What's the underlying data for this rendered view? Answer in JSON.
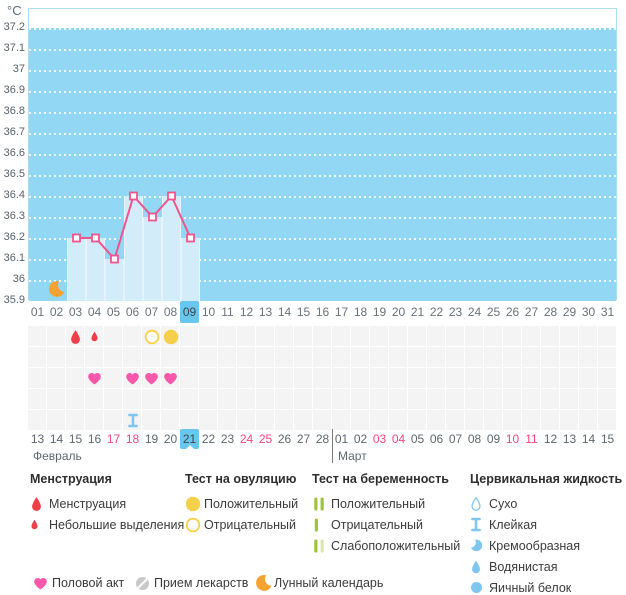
{
  "chart_data": {
    "type": "line",
    "ylabel": "°C",
    "ylim": [
      35.9,
      37.2
    ],
    "y_ticks": [
      "37.2",
      "37.1",
      "37",
      "36.9",
      "36.8",
      "36.7",
      "36.6",
      "36.5",
      "36.4",
      "36.3",
      "36.2",
      "36.1",
      "36",
      "35.9"
    ],
    "x_cycle_days": [
      "01",
      "02",
      "03",
      "04",
      "05",
      "06",
      "07",
      "08",
      "09",
      "10",
      "11",
      "12",
      "13",
      "14",
      "15",
      "16",
      "17",
      "18",
      "19",
      "20",
      "21",
      "22",
      "23",
      "24",
      "25",
      "26",
      "27",
      "28",
      "29",
      "30",
      "31"
    ],
    "current_cycle_day": "09",
    "series": [
      {
        "name": "temperature",
        "points": [
          {
            "day": "03",
            "temp": 36.2
          },
          {
            "day": "04",
            "temp": 36.2
          },
          {
            "day": "05",
            "temp": 36.1
          },
          {
            "day": "06",
            "temp": 36.4
          },
          {
            "day": "07",
            "temp": 36.3
          },
          {
            "day": "08",
            "temp": 36.4
          },
          {
            "day": "09",
            "temp": 36.2
          }
        ]
      }
    ],
    "markers_on_chart": [
      {
        "day": "02",
        "icon": "moon-orange"
      }
    ],
    "event_rows": [
      {
        "name": "menstruation-and-ovulation-tests",
        "items": [
          {
            "day": "03",
            "icon": "drop-large-red"
          },
          {
            "day": "04",
            "icon": "drop-small-red"
          },
          {
            "day": "07",
            "icon": "circle-outline-yellow"
          },
          {
            "day": "08",
            "icon": "circle-filled-yellow"
          }
        ]
      },
      {
        "name": "row-empty-1",
        "items": []
      },
      {
        "name": "intercourse",
        "items": [
          {
            "day": "04",
            "icon": "heart-pink"
          },
          {
            "day": "06",
            "icon": "heart-pink"
          },
          {
            "day": "07",
            "icon": "heart-pink"
          },
          {
            "day": "08",
            "icon": "heart-pink"
          }
        ]
      },
      {
        "name": "row-empty-2",
        "items": []
      },
      {
        "name": "cervical-fluid",
        "items": [
          {
            "day": "06",
            "icon": "ibeam-blue"
          }
        ]
      }
    ],
    "calendar": {
      "months": [
        {
          "name": "Февраль",
          "dates": [
            "13",
            "14",
            "15",
            "16",
            "17",
            "18",
            "19",
            "20",
            "21",
            "22",
            "23",
            "24",
            "25",
            "26",
            "27",
            "28"
          ],
          "weekend_dates": [
            "17",
            "18",
            "24",
            "25"
          ],
          "today": "21"
        },
        {
          "name": "Март",
          "dates": [
            "01",
            "02",
            "03",
            "04",
            "05",
            "06",
            "07",
            "08",
            "09",
            "10",
            "11",
            "12",
            "13",
            "14",
            "15"
          ],
          "weekend_dates": [
            "03",
            "04",
            "10",
            "11"
          ]
        }
      ]
    }
  },
  "legend": {
    "groups": [
      {
        "title": "Менструация",
        "items": [
          {
            "icon": "drop-large-red",
            "label": "Менструация"
          },
          {
            "icon": "drop-small-red",
            "label": "Небольшие выделения"
          }
        ]
      },
      {
        "title": "Тест на овуляцию",
        "items": [
          {
            "icon": "circle-filled-yellow",
            "label": "Положительный"
          },
          {
            "icon": "circle-outline-yellow",
            "label": "Отрицательный"
          }
        ]
      },
      {
        "title": "Тест на беременность",
        "items": [
          {
            "icon": "bars-two-green",
            "label": "Положительный"
          },
          {
            "icon": "bar-one-green",
            "label": "Отрицательный"
          },
          {
            "icon": "bars-green-pale",
            "label": "Слабоположительный"
          }
        ]
      },
      {
        "title": "Цервикальная жидкость",
        "items": [
          {
            "icon": "drop-outline-blue",
            "label": "Сухо"
          },
          {
            "icon": "ibeam-blue",
            "label": "Клейкая"
          },
          {
            "icon": "crescent-blue",
            "label": "Кремообразная"
          },
          {
            "icon": "drop-filled-blue",
            "label": "Водянистая"
          },
          {
            "icon": "circle-filled-blue",
            "label": "Яичный белок"
          }
        ]
      }
    ],
    "footer_items": [
      {
        "icon": "heart-pink",
        "label": "Половой акт"
      },
      {
        "icon": "pill-gray",
        "label": "Прием лекарств"
      },
      {
        "icon": "moon-orange",
        "label": "Лунный календарь"
      }
    ]
  },
  "colors": {
    "plot_bg": "#92d7f3",
    "bar": "#d2ecfa",
    "line": "#f1538c",
    "highlight": "#68c7ed",
    "red": "#ee3f4a",
    "yellow": "#f6cf4b",
    "pink": "#f957a9",
    "blue": "#7fc6ef",
    "green": "#9cc33b",
    "green_pale": "#dae6ae",
    "gray": "#c9c9c9",
    "orange": "#f6a233",
    "weekend": "#f4467e"
  }
}
